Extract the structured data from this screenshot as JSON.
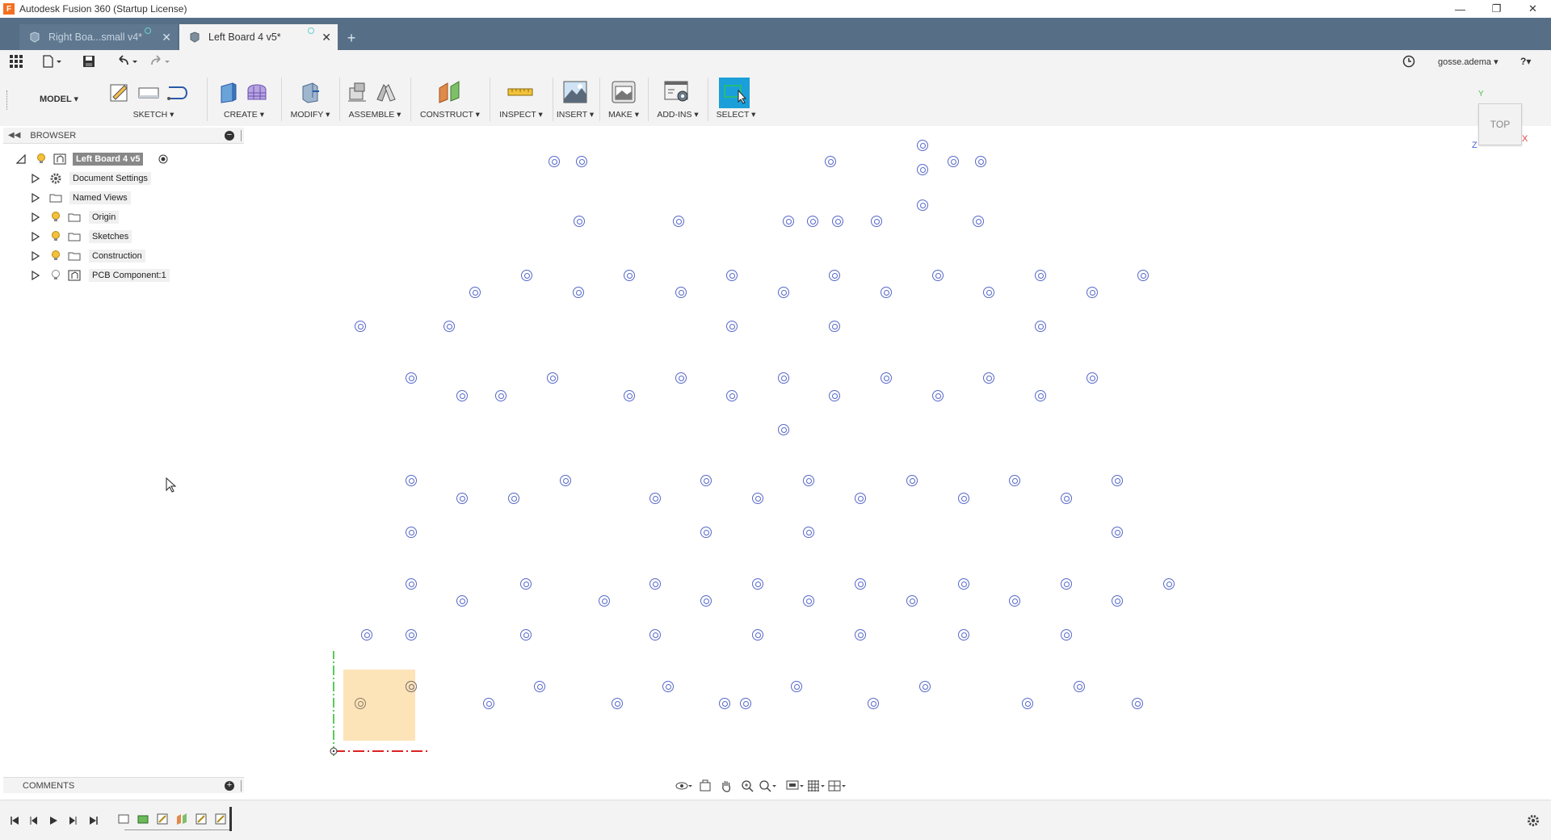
{
  "window": {
    "title": "Autodesk Fusion 360 (Startup License)",
    "logo_letter": "F",
    "minimize": "—",
    "restore": "❐",
    "close": "✕"
  },
  "tabs": [
    {
      "label": "Right Boa...small v4*",
      "active": false
    },
    {
      "label": "Left Board 4 v5*",
      "active": true
    }
  ],
  "new_tab": "+",
  "quick_access": {
    "user": "gosse.adema ▾",
    "help": "?▾"
  },
  "toolbar": {
    "workspace": "MODEL ▾",
    "groups": [
      {
        "label": "SKETCH ▾"
      },
      {
        "label": "CREATE ▾"
      },
      {
        "label": "MODIFY ▾"
      },
      {
        "label": "ASSEMBLE ▾"
      },
      {
        "label": "CONSTRUCT ▾"
      },
      {
        "label": "INSPECT ▾"
      },
      {
        "label": "INSERT ▾"
      },
      {
        "label": "MAKE ▾"
      },
      {
        "label": "ADD-INS ▾"
      },
      {
        "label": "SELECT ▾"
      }
    ]
  },
  "browser": {
    "title": "BROWSER",
    "root": "Left Board 4 v5",
    "items": [
      {
        "label": "Document Settings",
        "icon": "gear-icon"
      },
      {
        "label": "Named Views",
        "icon": "folder-icon"
      },
      {
        "label": "Origin",
        "icon": "folder-icon"
      },
      {
        "label": "Sketches",
        "icon": "folder-icon"
      },
      {
        "label": "Construction",
        "icon": "folder-icon"
      },
      {
        "label": "PCB Component:1",
        "icon": "component-icon"
      }
    ]
  },
  "viewcube": {
    "face": "TOP",
    "axis_x": "X",
    "axis_y": "Y",
    "axis_z": "Z"
  },
  "comments": {
    "title": "COMMENTS"
  },
  "colors": {
    "tab_bar": "#566f86",
    "hole_stroke": "#5668c9",
    "sketch_fill": "#fde3b8",
    "axis_green": "#22bb22",
    "axis_red": "#dd2222",
    "select_active": "#1a9fd9"
  }
}
